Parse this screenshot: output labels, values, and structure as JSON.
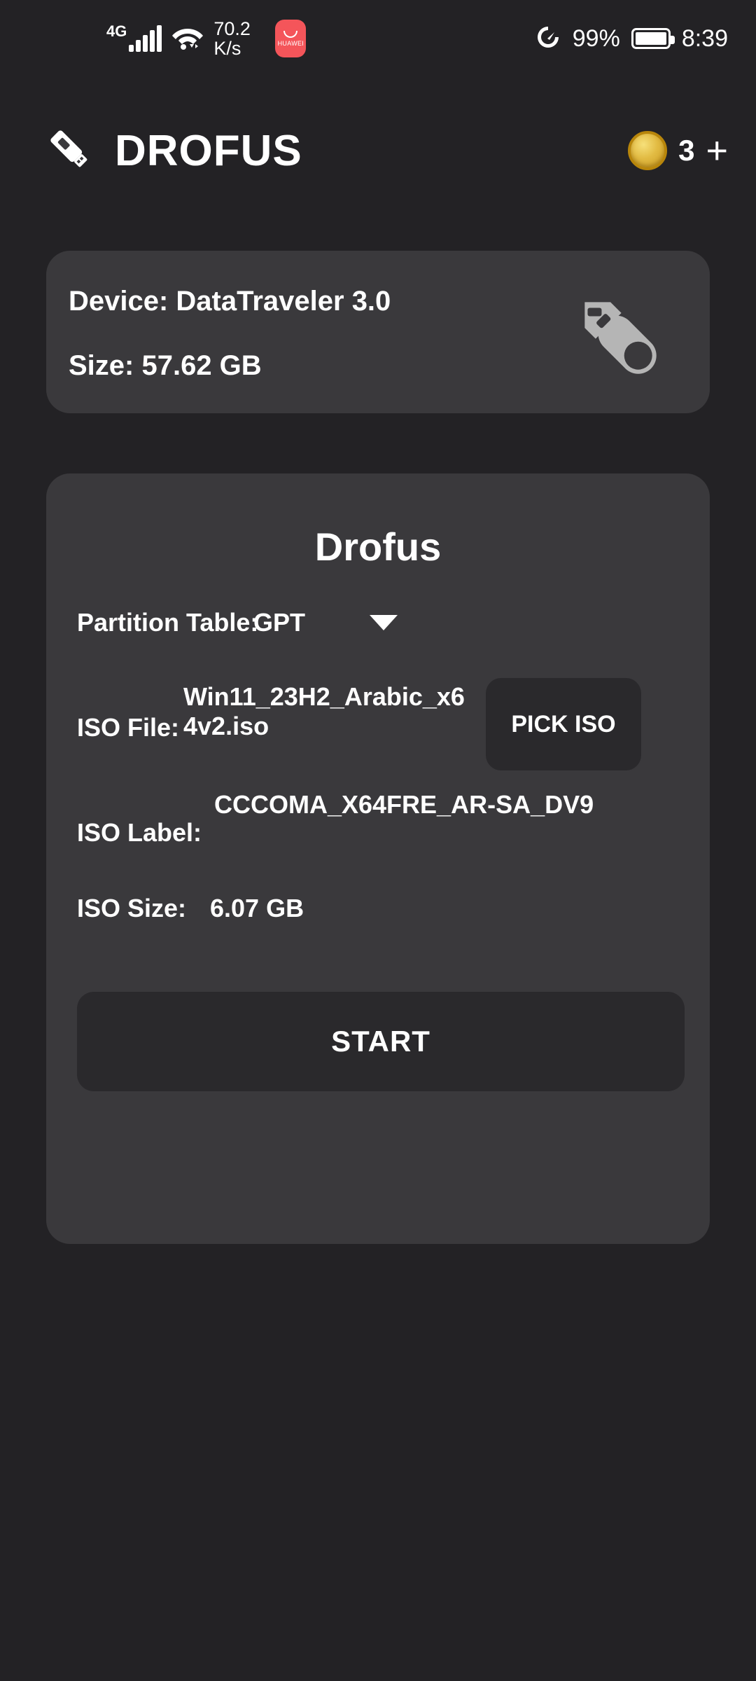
{
  "status_bar": {
    "network_type": "4G",
    "net_speed": "70.2 K/s",
    "app_icon_label": "HUAWEI",
    "battery_percent": "99%",
    "time": "8:39"
  },
  "header": {
    "app_title": "DROFUS",
    "coin_count": "3",
    "add_label": "+"
  },
  "device_card": {
    "device_line": "Device: DataTraveler 3.0",
    "size_line": "Size: 57.62 GB"
  },
  "panel": {
    "title": "Drofus",
    "partition_label": "Partition Table:",
    "partition_value": "GPT",
    "iso_file_label": "ISO File:",
    "iso_file_value": "Win11_23H2_Arabic_x64v2.iso",
    "pick_iso_label": "PICK ISO",
    "iso_label_label": "ISO Label:",
    "iso_label_value": "CCCOMA_X64FRE_AR-SA_DV9",
    "iso_size_label": "ISO Size:",
    "iso_size_value": "6.07 GB",
    "start_label": "START"
  },
  "colors": {
    "page_background": "#232225",
    "card_background": "#3a393c",
    "button_background": "#2a292c",
    "text": "#ffffff",
    "coin_gold": "#e2bb43",
    "usb_icon_gray": "#b5b5b5",
    "huawei_red": "#f4555a"
  }
}
